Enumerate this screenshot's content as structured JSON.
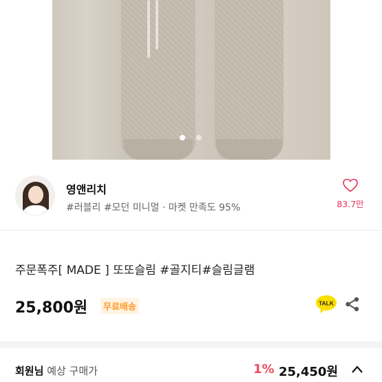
{
  "gallery": {
    "page_count": 2,
    "active_index": 0
  },
  "seller": {
    "name": "영앤리치",
    "tags": "#러블리 #모던 미니멀 · 마켓 만족도 95%",
    "likes": "83.7만",
    "like_icon": "heart-outline-icon"
  },
  "product": {
    "title": "주문폭주[ MADE ] 또또슬림 #골지티#슬림글램",
    "price": "25,800원",
    "shipping": "무료배송",
    "talk_label": "TALK"
  },
  "member": {
    "label_strong": "회원님",
    "label_weak": "예상 구매가",
    "discount": "1%",
    "price": "25,450원"
  },
  "colors": {
    "accent_pink": "#e5335a",
    "discount_red": "#f04a5e",
    "shipping_orange": "#ff9a2a",
    "kakao_yellow": "#f9e000"
  }
}
